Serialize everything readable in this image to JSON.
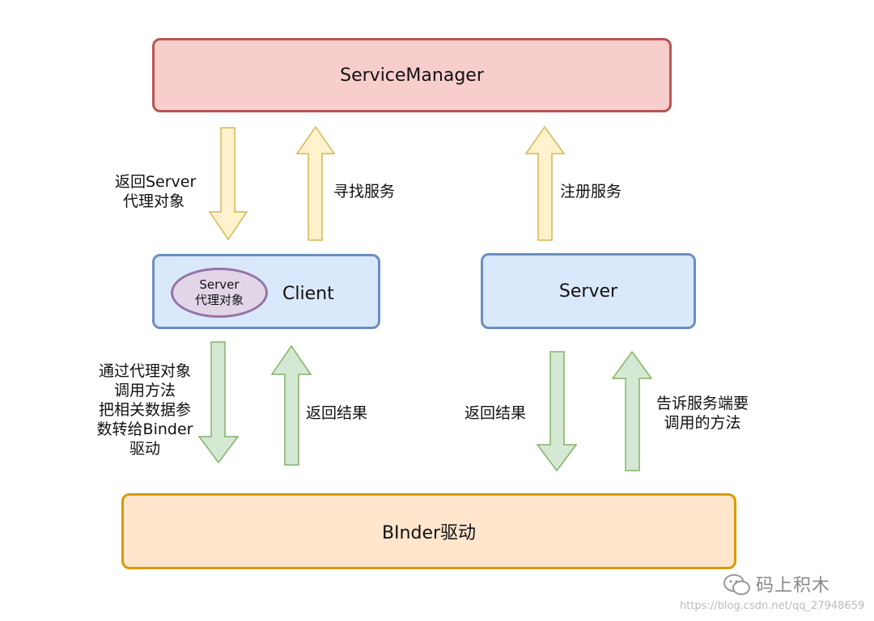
{
  "nodes": {
    "service_manager": "ServiceManager",
    "client": "Client",
    "proxy_line1": "Server",
    "proxy_line2": "代理对象",
    "server": "Server",
    "binder": "BInder驱动"
  },
  "edges": {
    "return_proxy_line1": "返回Server",
    "return_proxy_line2": "代理对象",
    "find_service": "寻找服务",
    "register_service": "注册服务",
    "client_call_line1": "通过代理对象",
    "client_call_line2": "调用方法",
    "client_call_line3": "把相关数据参",
    "client_call_line4": "数转给Binder",
    "client_call_line5": "驱动",
    "client_result": "返回结果",
    "server_result": "返回结果",
    "server_notify_line1": "告诉服务端要",
    "server_notify_line2": "调用的方法"
  },
  "colors": {
    "service_manager_fill": "#f8cecc",
    "service_manager_border": "#b85450",
    "node_fill_blue": "#dae8fc",
    "node_border_blue": "#6c8ebf",
    "binder_fill": "#ffe6cc",
    "binder_border": "#d79b00",
    "proxy_fill": "#e1d5e7",
    "proxy_border": "#9673a6",
    "arrow_yellow_fill": "#fff2cc",
    "arrow_yellow_border": "#d6b656",
    "arrow_green_fill": "#d5e8d4",
    "arrow_green_border": "#82b366"
  },
  "watermark": {
    "brand": "码上积木",
    "url": "https://blog.csdn.net/qq_27948659"
  }
}
